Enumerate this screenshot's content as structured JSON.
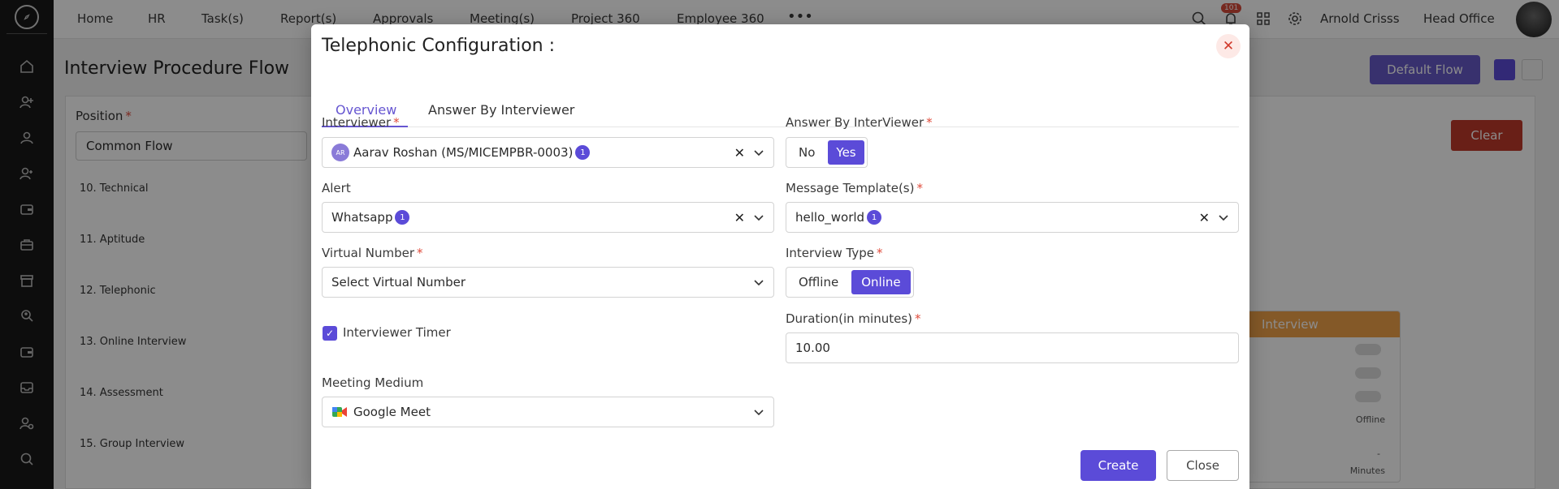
{
  "nav": {
    "links": [
      "Home",
      "HR",
      "Task(s)",
      "Report(s)",
      "Approvals",
      "Meeting(s)",
      "Project 360",
      "Employee 360"
    ],
    "more_icon": "ellipsis-icon",
    "notification_count": "101",
    "user_name": "Arnold Crisss",
    "location": "Head Office"
  },
  "background": {
    "page_title": "Interview Procedure Flow",
    "default_flow_label": "Default Flow",
    "position_label": "Position",
    "position_value": "Common Flow",
    "stages": [
      "10. Technical",
      "11. Aptitude",
      "12. Telephonic",
      "13. Online Interview",
      "14. Assessment",
      "15. Group Interview"
    ],
    "clear_label": "Clear",
    "card_title": "Interview",
    "card_offline": "Offline",
    "card_minutes": "Minutes",
    "card_dash": "-"
  },
  "modal": {
    "title": "Telephonic Configuration :",
    "tabs": [
      {
        "label": "Overview",
        "active": true
      },
      {
        "label": "Answer By Interviewer",
        "active": false
      }
    ],
    "interviewer": {
      "label": "Interviewer",
      "avatar": "AR",
      "value": "Aarav Roshan (MS/MICEMPBR-0003)",
      "count": "1"
    },
    "answer_by_interviewer": {
      "label": "Answer By InterViewer",
      "options": [
        "No",
        "Yes"
      ],
      "selected": "Yes"
    },
    "alert": {
      "label": "Alert",
      "value": "Whatsapp",
      "count": "1"
    },
    "message_template": {
      "label": "Message Template(s)",
      "value": "hello_world",
      "count": "1"
    },
    "virtual_number": {
      "label": "Virtual Number",
      "placeholder": "Select Virtual Number"
    },
    "interview_type": {
      "label": "Interview Type",
      "options": [
        "Offline",
        "Online"
      ],
      "selected": "Online"
    },
    "interviewer_timer": {
      "label": "Interviewer Timer",
      "checked": true
    },
    "duration": {
      "label": "Duration(in minutes)",
      "value": "10.00"
    },
    "meeting_medium": {
      "label": "Meeting Medium",
      "value": "Google Meet",
      "icon": "google-meet-icon"
    },
    "create_label": "Create",
    "close_label": "Close",
    "required_mark": "*"
  },
  "colors": {
    "accent": "#5b4bd8",
    "danger": "#d0392b",
    "rail": "#191919"
  }
}
